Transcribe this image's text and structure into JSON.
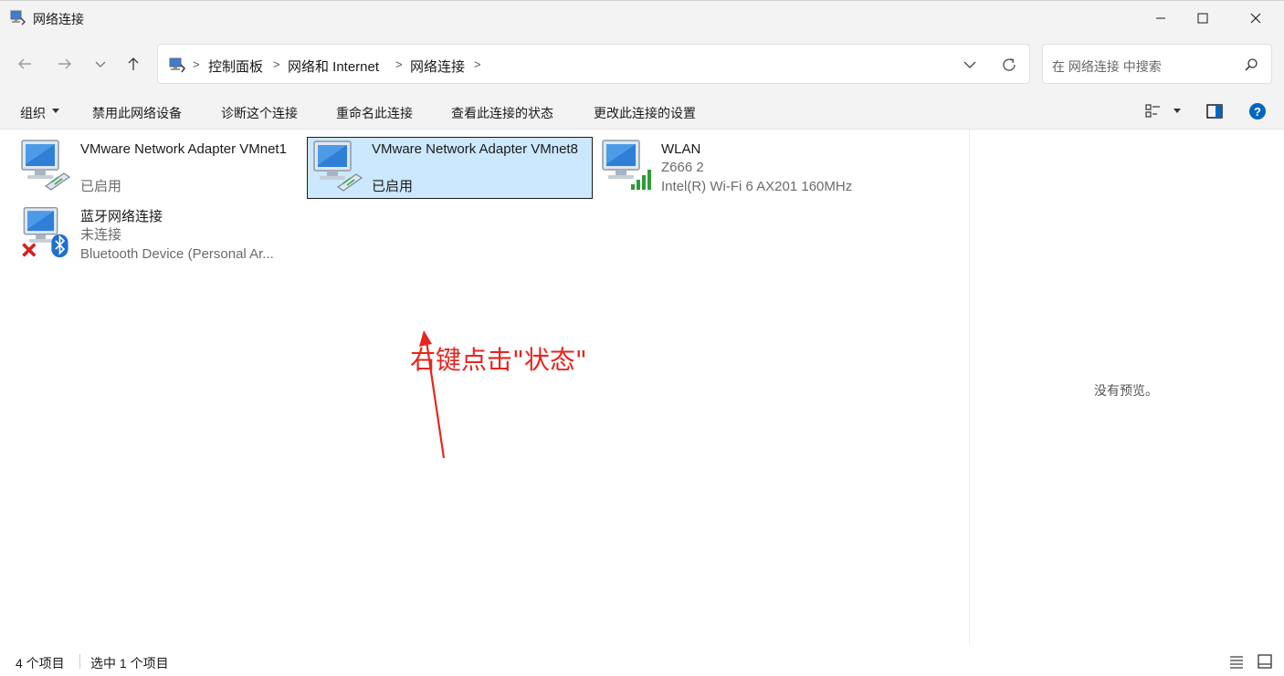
{
  "window": {
    "title": "网络连接",
    "colors": {
      "titlebar": "#f3f3f3",
      "selection": "#cce8ff",
      "help": "#0067c0",
      "annotation": "#e6251f"
    }
  },
  "address": {
    "breadcrumbs": [
      "控制面板",
      "网络和 Internet",
      "网络连接"
    ],
    "separator": ">"
  },
  "search": {
    "placeholder": "在 网络连接 中搜索"
  },
  "toolbar": {
    "organize": "组织",
    "disable": "禁用此网络设备",
    "diagnose": "诊断这个连接",
    "rename": "重命名此连接",
    "view_status": "查看此连接的状态",
    "change_settings": "更改此连接的设置"
  },
  "connections": [
    {
      "name": "VMware Network Adapter VMnet1",
      "status": "已启用",
      "icon": "ethernet-adapter-icon"
    },
    {
      "name": "VMware Network Adapter VMnet8",
      "status": "已启用",
      "icon": "ethernet-adapter-icon",
      "selected": true
    },
    {
      "name": "WLAN",
      "network": "Z666 2",
      "device": "Intel(R) Wi-Fi 6 AX201 160MHz",
      "icon": "wifi-adapter-icon"
    },
    {
      "name": "蓝牙网络连接",
      "status": "未连接",
      "device": "Bluetooth Device (Personal Ar...",
      "icon": "bluetooth-adapter-icon"
    }
  ],
  "preview": {
    "text": "没有预览。"
  },
  "annotation": {
    "text": "右键点击\"状态\""
  },
  "status": {
    "count": "4 个项目",
    "selected": "选中 1 个项目"
  }
}
